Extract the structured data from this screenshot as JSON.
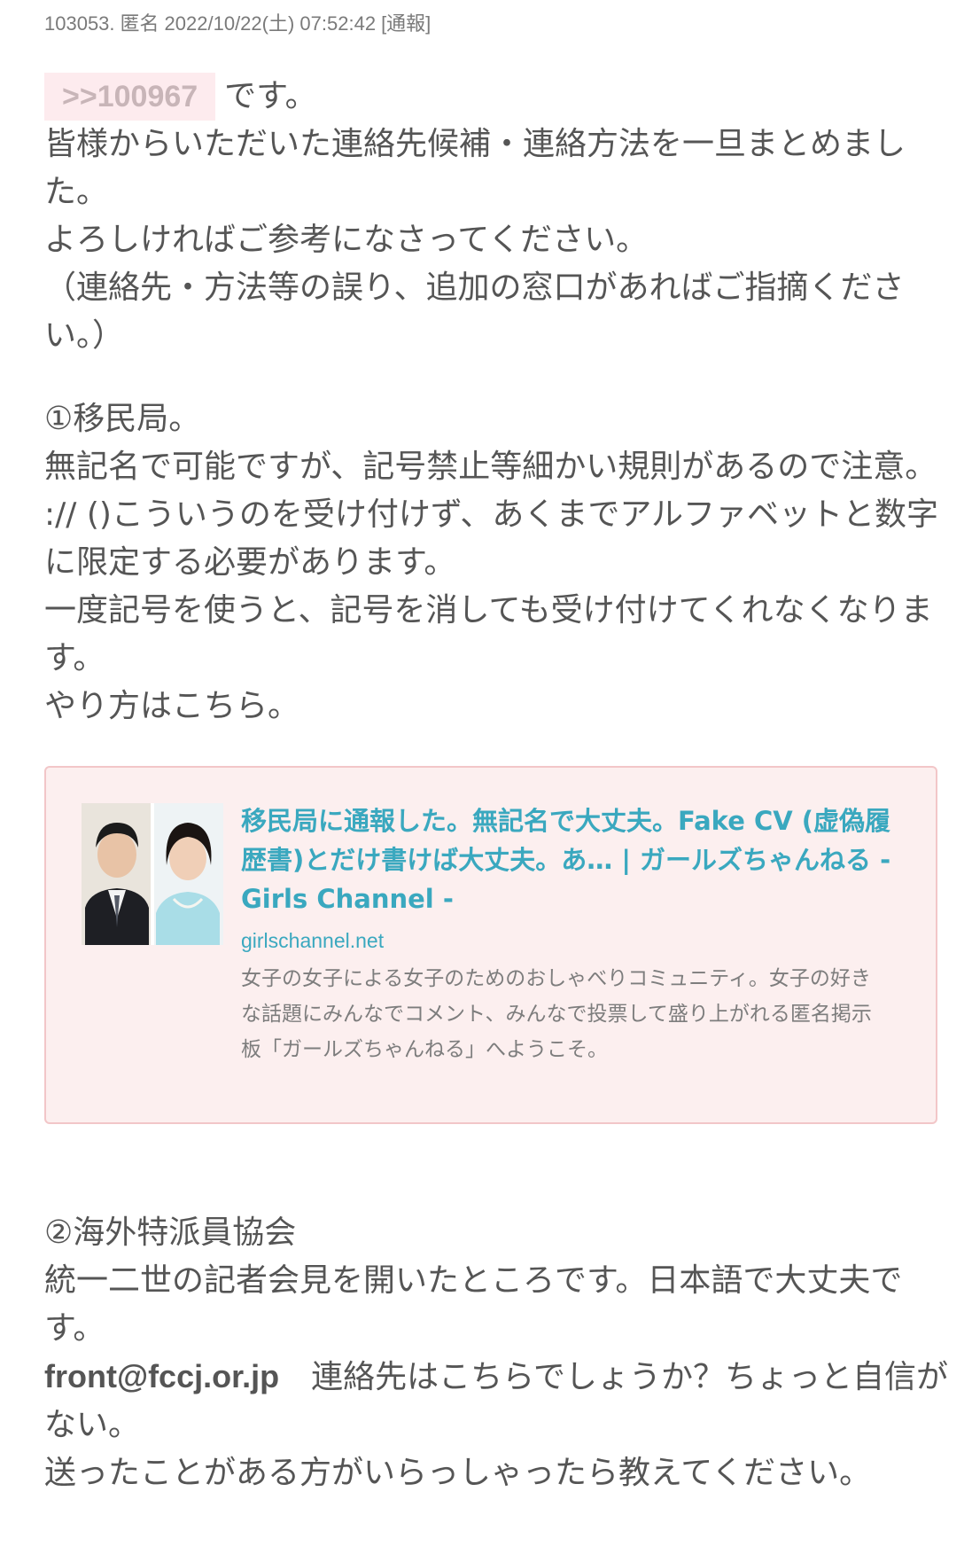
{
  "meta": {
    "number": "103053.",
    "name": "匿名",
    "datetime": "2022/10/22(土) 07:52:42",
    "report": "[通報]"
  },
  "body": {
    "anchor": ">>100967",
    "anchor_tail": "です。",
    "lines_a": [
      "皆様からいただいた連絡先候補・連絡方法を一旦まとめまし",
      "た。",
      "よろしければご参考になさってください。",
      "（連絡先・方法等の誤り、追加の窓口があればご指摘くださ",
      "い。）"
    ],
    "lines_b": [
      "①移民局。",
      "無記名で可能ですが、記号禁止等細かい規則があるので注意。",
      ":// ()こういうのを受け付けず、あくまでアルファベットと数字",
      "に限定する必要があります。",
      "一度記号を使うと、記号を消しても受け付けてくれなくなりま",
      "す。",
      "やり方はこちら。"
    ],
    "lines_c_1": [
      "②海外特派員協会",
      "統一二世の記者会見を開いたところです。日本語で大丈夫で",
      "す。"
    ],
    "email": "front@fccj.or.jp",
    "email_tail": "　連絡先はこちらでしょうか？ちょっと自信が",
    "lines_c_2": [
      "ない。",
      "送ったことがある方がいらっしゃったら教えてください。"
    ]
  },
  "link_card": {
    "title_lines": [
      "移民局に通報した。無記名で大丈夫。Fake CV (虚偽履",
      "歴書)とだけ書けば大丈夫。あ… | ガールズちゃんねる -",
      "Girls Channel -"
    ],
    "domain": "girlschannel.net",
    "desc_lines": [
      "女子の女子による女子のためのおしゃべりコミュニティ。女子の好き",
      "な話題にみんなでコメント、みんなで投票して盛り上がれる匿名掲示",
      "板「ガールズちゃんねる」へようこそ。"
    ],
    "thumbnail_icon": "photo-thumbnail"
  },
  "colors": {
    "text": "#555555",
    "link": "#3aa8bf",
    "anchor_bg": "#fdebee",
    "card_bg": "#fcefef",
    "card_border": "#f2c6c8"
  }
}
